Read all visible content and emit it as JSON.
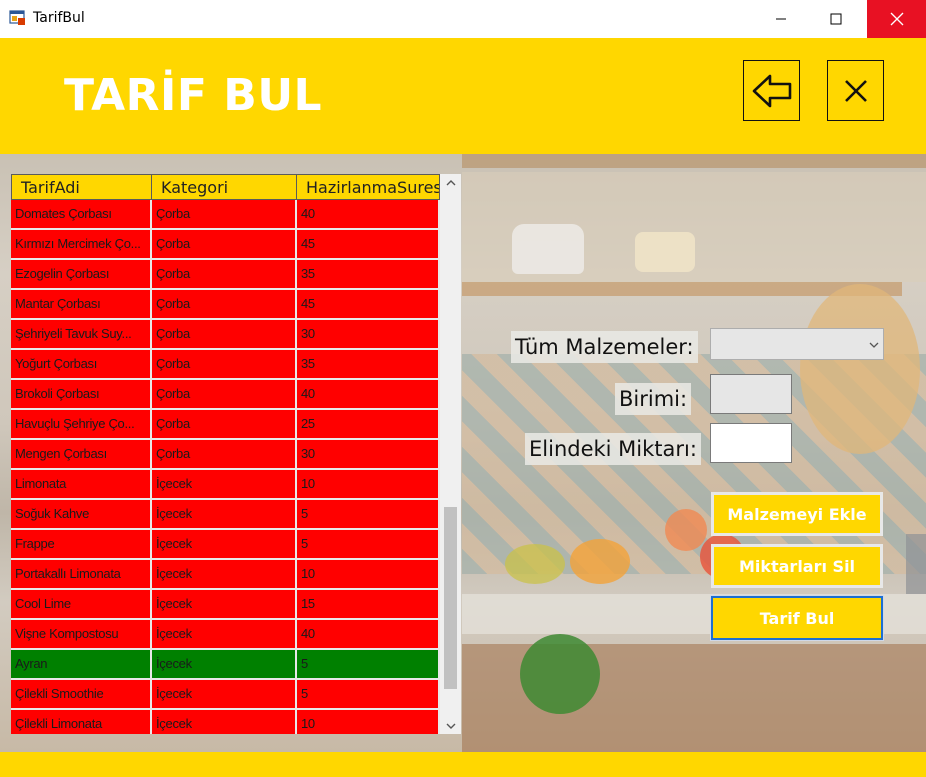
{
  "window": {
    "title": "TarifBul",
    "icons": {
      "app": "app-window-icon",
      "minimize": "minimize-icon",
      "maximize": "maximize-icon",
      "close": "close-icon"
    }
  },
  "header": {
    "title": "TARİF BUL",
    "back_icon": "arrow-left-icon",
    "close_icon": "close-icon",
    "background": "#ffd700"
  },
  "grid": {
    "columns": [
      "TarifAdi",
      "Kategori",
      "HazirlanmaSuresi"
    ],
    "rows": [
      {
        "name": "Domates Çorbası",
        "category": "Çorba",
        "time": "40",
        "status": "red"
      },
      {
        "name": "Kırmızı Mercimek Ço...",
        "category": "Çorba",
        "time": "45",
        "status": "red"
      },
      {
        "name": "Ezogelin Çorbası",
        "category": "Çorba",
        "time": "35",
        "status": "red"
      },
      {
        "name": "Mantar Çorbası",
        "category": "Çorba",
        "time": "45",
        "status": "red"
      },
      {
        "name": "Şehriyeli Tavuk Suy...",
        "category": "Çorba",
        "time": "30",
        "status": "red"
      },
      {
        "name": "Yoğurt Çorbası",
        "category": "Çorba",
        "time": "35",
        "status": "red"
      },
      {
        "name": "Brokoli Çorbası",
        "category": "Çorba",
        "time": "40",
        "status": "red"
      },
      {
        "name": "Havuçlu Şehriye Ço...",
        "category": "Çorba",
        "time": "25",
        "status": "red"
      },
      {
        "name": "Mengen Çorbası",
        "category": "Çorba",
        "time": "30",
        "status": "red"
      },
      {
        "name": "Limonata",
        "category": "İçecek",
        "time": "10",
        "status": "red"
      },
      {
        "name": "Soğuk Kahve",
        "category": "İçecek",
        "time": "5",
        "status": "red"
      },
      {
        "name": "Frappe",
        "category": "İçecek",
        "time": "5",
        "status": "red"
      },
      {
        "name": "Portakallı Limonata",
        "category": "İçecek",
        "time": "10",
        "status": "red"
      },
      {
        "name": "Cool Lime",
        "category": "İçecek",
        "time": "15",
        "status": "red"
      },
      {
        "name": "Vişne Kompostosu",
        "category": "İçecek",
        "time": "40",
        "status": "red"
      },
      {
        "name": "Ayran",
        "category": "İçecek",
        "time": "5",
        "status": "green"
      },
      {
        "name": "Çilekli Smoothie",
        "category": "İçecek",
        "time": "5",
        "status": "red"
      },
      {
        "name": "Çilekli Limonata",
        "category": "İçecek",
        "time": "10",
        "status": "red"
      }
    ],
    "colors": {
      "missing": "#ff0000",
      "available": "#008000",
      "header": "#ffd700"
    }
  },
  "form": {
    "all_ingredients_label": "Tüm Malzemeler:",
    "all_ingredients_value": "",
    "unit_label": "Birimi:",
    "unit_value": "",
    "amount_label": "Elindeki Miktarı:",
    "amount_value": ""
  },
  "buttons": {
    "add_ingredient": "Malzemeyi Ekle",
    "clear_amounts": "Miktarları Sil",
    "find_recipe": "Tarif Bul"
  }
}
